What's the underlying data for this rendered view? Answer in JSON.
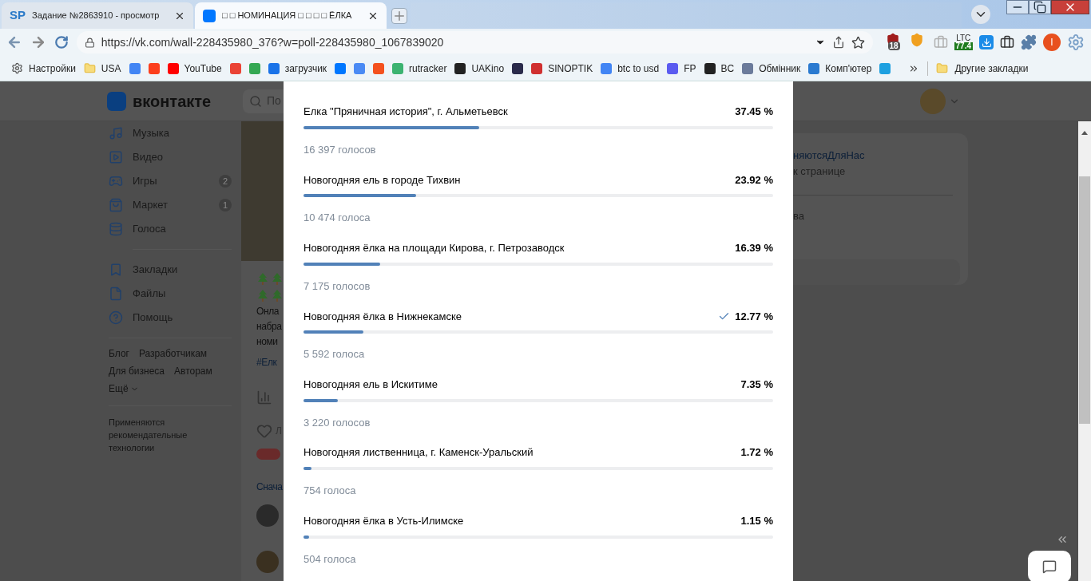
{
  "tabs": [
    {
      "favicon_text": "SP",
      "title": "Задание №2863910 - просмотр",
      "selected": false
    },
    {
      "title": "□ □ НОМИНАЦИЯ □ □ □ □ ЁЛКА",
      "selected": true
    }
  ],
  "address": {
    "url": "https://vk.com/wall-228435980_376?w=poll-228435980_1067839020"
  },
  "extensions": [
    {
      "kind": "shield",
      "badge": "18",
      "color": "#a11d1d"
    },
    {
      "kind": "shield",
      "color": "#f0a020"
    },
    {
      "kind": "box",
      "color": "#b0b0b0"
    },
    {
      "kind": "ltc",
      "label": "LTC",
      "badge": "77.4",
      "color": "#1e7b1e"
    },
    {
      "kind": "download",
      "color": "#1a8be8"
    },
    {
      "kind": "box",
      "color": "#333333"
    },
    {
      "kind": "puzzle",
      "color": "#5a7fa8"
    },
    {
      "kind": "avatar",
      "label": "I",
      "color": "#e8501e"
    },
    {
      "kind": "gear",
      "color": "#7aa0c8"
    }
  ],
  "bookmarks": [
    {
      "kind": "gear",
      "title": "Настройки"
    },
    {
      "kind": "folder",
      "title": "USA"
    },
    {
      "kind": "site",
      "color": "#4285f4"
    },
    {
      "kind": "site",
      "color": "#fc3f1d"
    },
    {
      "kind": "site",
      "title": "YouTube",
      "color": "#ff0000"
    },
    {
      "kind": "site",
      "color": "#ea4335"
    },
    {
      "kind": "site",
      "color": "#34a853"
    },
    {
      "kind": "site",
      "title": "загрузчик",
      "color": "#1a73e8"
    },
    {
      "kind": "site",
      "color": "#0077ff"
    },
    {
      "kind": "site",
      "color": "#4a8af4"
    },
    {
      "kind": "site",
      "color": "#f4511e"
    },
    {
      "kind": "site",
      "title": "rutracker",
      "color": "#3cb371"
    },
    {
      "kind": "site",
      "title": "UAKino",
      "color": "#222222"
    },
    {
      "kind": "site",
      "color": "#2b2b4b"
    },
    {
      "kind": "site",
      "title": "SINOPTIK",
      "color": "#d03030"
    },
    {
      "kind": "site",
      "title": "btc to usd",
      "color": "#4285f4"
    },
    {
      "kind": "site",
      "title": "FP",
      "color": "#5b5bf0"
    },
    {
      "kind": "site",
      "title": "BC",
      "color": "#222222"
    },
    {
      "kind": "site",
      "title": "Обмінник",
      "color": "#6b7b9b"
    },
    {
      "kind": "site",
      "title": "Комп'ютер",
      "color": "#2a7ad0"
    },
    {
      "kind": "site",
      "color": "#1ea0e0"
    }
  ],
  "other_bookmarks": "Другие закладки",
  "vk": {
    "logo": "вконтакте",
    "search_placeholder": "По"
  },
  "sidebar": {
    "items": [
      {
        "label": "Музыка"
      },
      {
        "label": "Видео"
      },
      {
        "label": "Игры",
        "badge": "2"
      },
      {
        "label": "Маркет",
        "badge": "1"
      },
      {
        "label": "Голоса"
      },
      {
        "label": "Закладки"
      },
      {
        "label": "Файлы"
      },
      {
        "label": "Помощь"
      }
    ],
    "footer_links": [
      "Блог",
      "Разработчикам",
      "Для бизнеса",
      "Авторам"
    ],
    "more": "Ещё",
    "note": "Применяются рекомендательные технологии"
  },
  "feed": {
    "text_lines": [
      "Онла",
      "набра",
      "номи"
    ],
    "hashtag": "#Елк",
    "like": "Л",
    "sort": "Снача"
  },
  "right_card": {
    "tag": "няютсяДляНас",
    "line": "к странице",
    "item": "ва"
  },
  "poll": [
    {
      "title": "Елка \"Пряничная история\", г. Альметьевск",
      "percent": "37.45 %",
      "votes": "16 397 голосов",
      "level": 0.3745,
      "voted": false
    },
    {
      "title": "Новогодняя ель в городе Тихвин",
      "percent": "23.92 %",
      "votes": "10 474 голоса",
      "level": 0.2392,
      "voted": false
    },
    {
      "title": "Новогодняя ёлка на площади Кирова, г. Петрозаводск",
      "percent": "16.39 %",
      "votes": "7 175 голосов",
      "level": 0.1639,
      "voted": false
    },
    {
      "title": "Новогодняя ёлка в Нижнекамске",
      "percent": "12.77 %",
      "votes": "5 592 голоса",
      "level": 0.1277,
      "voted": true
    },
    {
      "title": "Новогодняя ель в Искитиме",
      "percent": "7.35 %",
      "votes": "3 220 голосов",
      "level": 0.0735,
      "voted": false
    },
    {
      "title": "Новогодняя лиственница, г. Каменск-Уральский",
      "percent": "1.72 %",
      "votes": "754 голоса",
      "level": 0.0172,
      "voted": false
    },
    {
      "title": "Новогодняя ёлка в Усть-Илимске",
      "percent": "1.15 %",
      "votes": "504 голоса",
      "level": 0.0115,
      "voted": false
    }
  ]
}
